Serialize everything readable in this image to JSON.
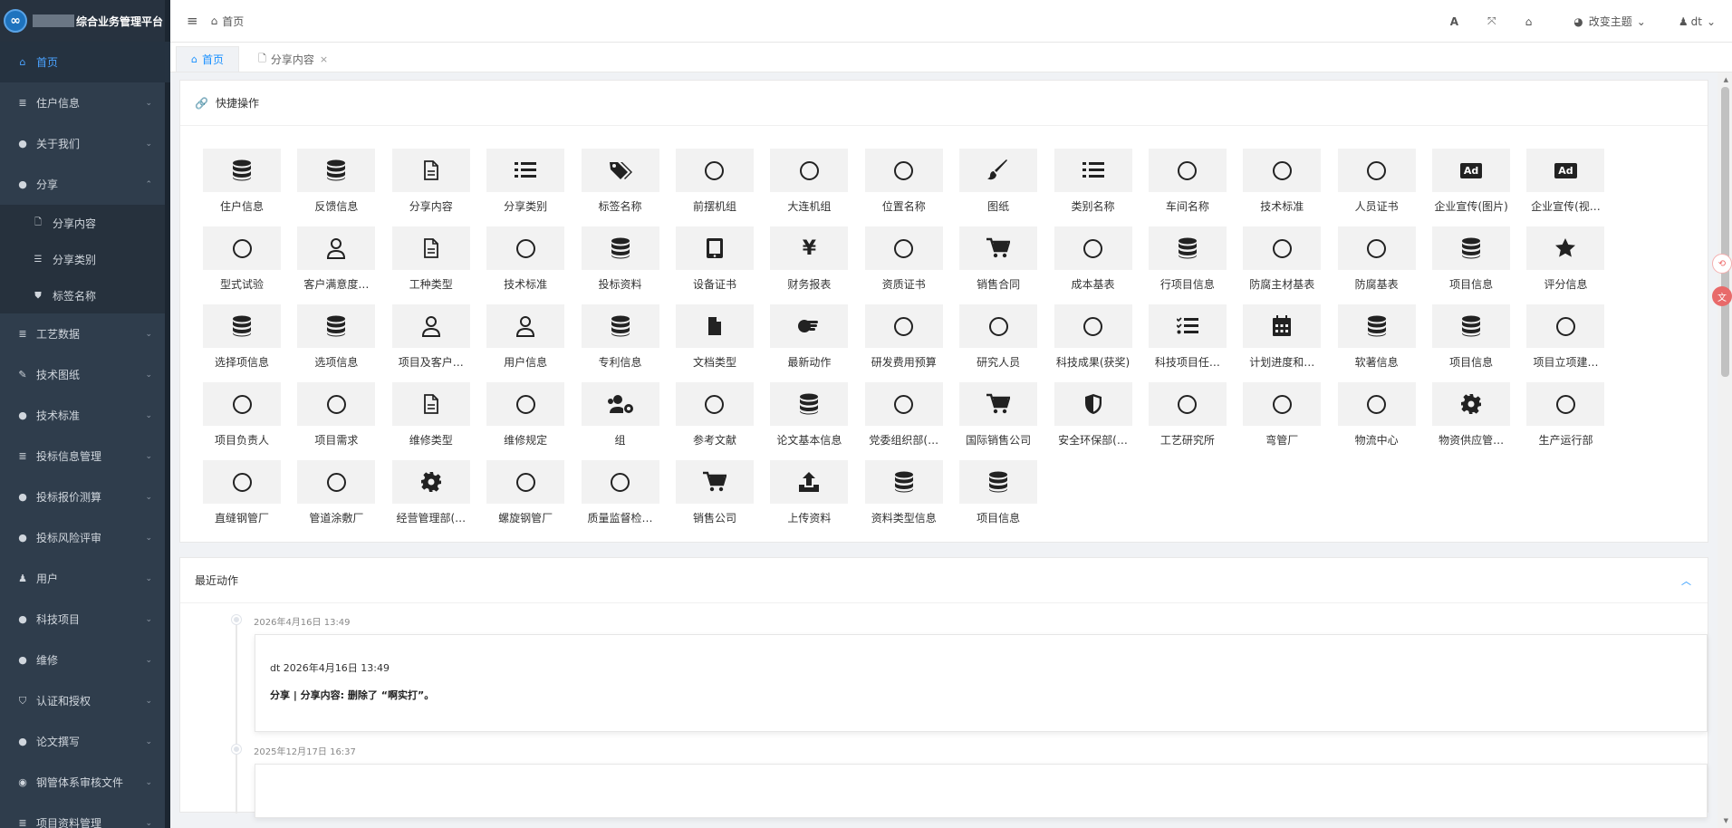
{
  "brand": {
    "title": "综合业务管理平台",
    "logo_icon": "infinity-logo"
  },
  "sidebar": {
    "items": [
      {
        "label": "首页",
        "icon": "home-icon",
        "glyph": "⌂",
        "active": true,
        "chevron": ""
      },
      {
        "label": "住户信息",
        "icon": "database-icon",
        "glyph": "≣",
        "chevron": "⌄"
      },
      {
        "label": "关于我们",
        "icon": "circle-icon",
        "glyph": "●",
        "chevron": "⌄"
      },
      {
        "label": "分享",
        "icon": "circle-icon",
        "glyph": "●",
        "chevron": "⌃"
      },
      {
        "label": "工艺数据",
        "icon": "database-icon",
        "glyph": "≣",
        "chevron": "⌄"
      },
      {
        "label": "技术图纸",
        "icon": "brush-icon",
        "glyph": "✎",
        "chevron": "⌄"
      },
      {
        "label": "技术标准",
        "icon": "circle-icon",
        "glyph": "●",
        "chevron": "⌄"
      },
      {
        "label": "投标信息管理",
        "icon": "database-icon",
        "glyph": "≣",
        "chevron": "⌄"
      },
      {
        "label": "投标报价测算",
        "icon": "circle-icon",
        "glyph": "●",
        "chevron": "⌄"
      },
      {
        "label": "投标风险评审",
        "icon": "circle-icon",
        "glyph": "●",
        "chevron": "⌄"
      },
      {
        "label": "用户",
        "icon": "user-icon",
        "glyph": "♟",
        "chevron": "⌄"
      },
      {
        "label": "科技项目",
        "icon": "circle-icon",
        "glyph": "●",
        "chevron": "⌄"
      },
      {
        "label": "维修",
        "icon": "circle-icon",
        "glyph": "●",
        "chevron": "⌄"
      },
      {
        "label": "认证和授权",
        "icon": "shield-icon",
        "glyph": "⛉",
        "chevron": "⌄"
      },
      {
        "label": "论文撰写",
        "icon": "circle-icon",
        "glyph": "●",
        "chevron": "⌄"
      },
      {
        "label": "钢管体系审核文件",
        "icon": "eye-icon",
        "glyph": "◉",
        "chevron": "⌄"
      },
      {
        "label": "项目资料管理",
        "icon": "database-icon",
        "glyph": "≣",
        "chevron": "⌄"
      }
    ],
    "sub_items": [
      {
        "label": "分享内容",
        "icon": "file-icon",
        "glyph": "🗋"
      },
      {
        "label": "分享类别",
        "icon": "list-icon",
        "glyph": "☰"
      },
      {
        "label": "标签名称",
        "icon": "tags-icon",
        "glyph": "⛊"
      }
    ]
  },
  "header": {
    "breadcrumb": "首页",
    "theme_label": "改变主题",
    "user_label": "dt"
  },
  "tabs": [
    {
      "label": "首页",
      "active": true
    },
    {
      "label": "分享内容",
      "active": false,
      "closable": true
    }
  ],
  "quick": {
    "title": "快捷操作",
    "items": [
      {
        "label": "住户信息",
        "icon": "database-icon"
      },
      {
        "label": "反馈信息",
        "icon": "database-icon"
      },
      {
        "label": "分享内容",
        "icon": "file-icon"
      },
      {
        "label": "分享类别",
        "icon": "list-icon"
      },
      {
        "label": "标签名称",
        "icon": "tags-icon"
      },
      {
        "label": "前摆机组",
        "icon": "circle-icon"
      },
      {
        "label": "大连机组",
        "icon": "circle-icon"
      },
      {
        "label": "位置名称",
        "icon": "circle-icon"
      },
      {
        "label": "图纸",
        "icon": "brush-icon"
      },
      {
        "label": "类别名称",
        "icon": "list-icon"
      },
      {
        "label": "车间名称",
        "icon": "circle-icon"
      },
      {
        "label": "技术标准",
        "icon": "circle-icon"
      },
      {
        "label": "人员证书",
        "icon": "circle-icon"
      },
      {
        "label": "企业宣传(图片)",
        "icon": "ad-icon"
      },
      {
        "label": "企业宣传(视…",
        "icon": "ad-icon"
      },
      {
        "label": "型式试验",
        "icon": "circle-icon"
      },
      {
        "label": "客户满意度…",
        "icon": "user-icon"
      },
      {
        "label": "工种类型",
        "icon": "file-icon"
      },
      {
        "label": "技术标准",
        "icon": "circle-icon"
      },
      {
        "label": "投标资料",
        "icon": "database-icon"
      },
      {
        "label": "设备证书",
        "icon": "tablet-icon"
      },
      {
        "label": "财务报表",
        "icon": "yen-icon"
      },
      {
        "label": "资质证书",
        "icon": "circle-icon"
      },
      {
        "label": "销售合同",
        "icon": "cart-icon"
      },
      {
        "label": "成本基表",
        "icon": "circle-icon"
      },
      {
        "label": "行项目信息",
        "icon": "database-icon"
      },
      {
        "label": "防腐主材基表",
        "icon": "circle-icon"
      },
      {
        "label": "防腐基表",
        "icon": "circle-icon"
      },
      {
        "label": "项目信息",
        "icon": "database-icon"
      },
      {
        "label": "评分信息",
        "icon": "star-icon"
      },
      {
        "label": "选择项信息",
        "icon": "database-icon"
      },
      {
        "label": "选项信息",
        "icon": "database-icon"
      },
      {
        "label": "项目及客户…",
        "icon": "user-icon"
      },
      {
        "label": "用户信息",
        "icon": "user-icon"
      },
      {
        "label": "专利信息",
        "icon": "database-icon"
      },
      {
        "label": "文档类型",
        "icon": "file-solid-icon"
      },
      {
        "label": "最新动作",
        "icon": "hand-icon"
      },
      {
        "label": "研发费用预算",
        "icon": "circle-icon"
      },
      {
        "label": "研究人员",
        "icon": "circle-icon"
      },
      {
        "label": "科技成果(获奖)",
        "icon": "circle-icon"
      },
      {
        "label": "科技项目任…",
        "icon": "checklist-icon"
      },
      {
        "label": "计划进度和…",
        "icon": "calendar-icon"
      },
      {
        "label": "软著信息",
        "icon": "database-icon"
      },
      {
        "label": "项目信息",
        "icon": "database-icon"
      },
      {
        "label": "项目立项建…",
        "icon": "circle-icon"
      },
      {
        "label": "项目负责人",
        "icon": "circle-icon"
      },
      {
        "label": "项目需求",
        "icon": "circle-icon"
      },
      {
        "label": "维修类型",
        "icon": "file-icon"
      },
      {
        "label": "维修规定",
        "icon": "circle-icon"
      },
      {
        "label": "组",
        "icon": "users-cog-icon"
      },
      {
        "label": "参考文献",
        "icon": "circle-icon"
      },
      {
        "label": "论文基本信息",
        "icon": "database-icon"
      },
      {
        "label": "党委组织部(…",
        "icon": "circle-icon"
      },
      {
        "label": "国际销售公司",
        "icon": "cart-icon"
      },
      {
        "label": "安全环保部(…",
        "icon": "shield-icon"
      },
      {
        "label": "工艺研究所",
        "icon": "circle-icon"
      },
      {
        "label": "弯管厂",
        "icon": "circle-icon"
      },
      {
        "label": "物流中心",
        "icon": "circle-icon"
      },
      {
        "label": "物资供应管…",
        "icon": "gear-icon"
      },
      {
        "label": "生产运行部",
        "icon": "circle-icon"
      },
      {
        "label": "直缝钢管厂",
        "icon": "circle-icon"
      },
      {
        "label": "管道涂敷厂",
        "icon": "circle-icon"
      },
      {
        "label": "经营管理部(…",
        "icon": "gear-icon"
      },
      {
        "label": "螺旋钢管厂",
        "icon": "circle-icon"
      },
      {
        "label": "质量监督检…",
        "icon": "circle-icon"
      },
      {
        "label": "销售公司",
        "icon": "cart-icon"
      },
      {
        "label": "上传资料",
        "icon": "upload-icon"
      },
      {
        "label": "资料类型信息",
        "icon": "database-icon"
      },
      {
        "label": "项目信息",
        "icon": "database-icon"
      }
    ]
  },
  "recent": {
    "title": "最近动作",
    "entries": [
      {
        "time": "2026年4月16日 13:49",
        "who": "dt 2026年4月16日 13:49",
        "desc": "分享 | 分享内容: 删除了 “啊实打”。"
      },
      {
        "time": "2025年12月17日 16:37",
        "who": "",
        "desc": ""
      }
    ]
  },
  "colors": {
    "sidebar_bg": "#2f3d4c",
    "accent": "#1890ff",
    "active_menu": "#4aa3ff"
  }
}
